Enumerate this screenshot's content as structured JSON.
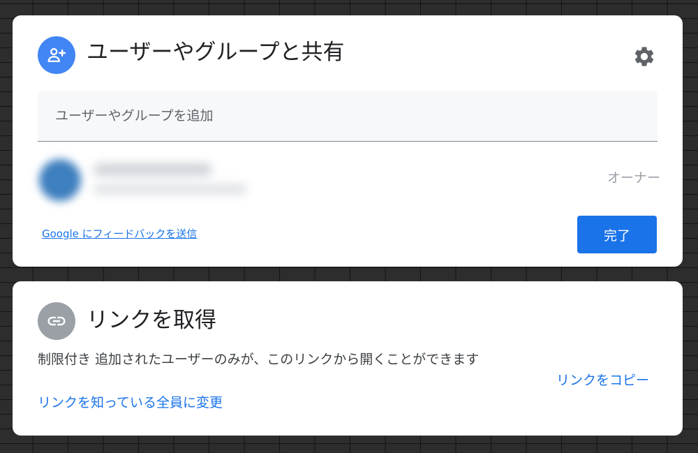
{
  "share_dialog": {
    "title": "ユーザーやグループと共有",
    "icon": "person-add-icon",
    "settings_icon": "gear-icon",
    "input_placeholder": "ユーザーやグループを追加",
    "owner": {
      "role": "オーナー"
    },
    "feedback_link": "Google にフィードバックを送信",
    "done_label": "完了"
  },
  "link_dialog": {
    "title": "リンクを取得",
    "icon": "link-icon",
    "description": "制限付き 追加されたユーザーのみが、このリンクから開くことができます",
    "change_link": "リンクを知っている全員に変更",
    "copy_link": "リンクをコピー"
  },
  "colors": {
    "accent": "#1a73e8",
    "share_icon_bg": "#4285f4",
    "link_icon_bg": "#9aa0a6",
    "backdrop": "#2d2d2d"
  }
}
